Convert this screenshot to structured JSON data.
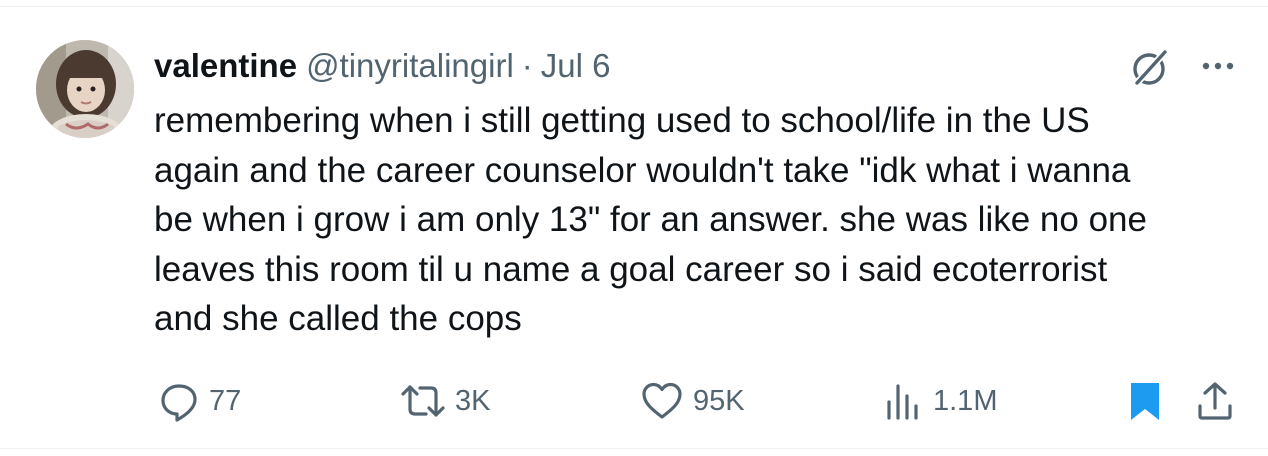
{
  "tweet": {
    "display_name": "valentine",
    "handle": "@tinyritalingirl",
    "separator": "·",
    "date": "Jul 6",
    "text": "remembering when i still getting used to school/life in the US\nagain and the career counselor wouldn't take \"idk what i wanna\nbe when i grow i am only 13\" for an answer. she was like no one\nleaves this room til u name a goal career so i said ecoterrorist\nand she called the cops"
  },
  "actions": {
    "replies": "77",
    "reposts": "3K",
    "likes": "95K",
    "views": "1.1M"
  },
  "colors": {
    "text": "#0f1419",
    "secondary": "#536471",
    "bookmark": "#1d9bf0",
    "divider": "#eff3f4"
  },
  "icons": {
    "reply": "reply-icon",
    "repost": "repost-icon",
    "like": "heart-icon",
    "views": "views-icon",
    "bookmark": "bookmark-icon",
    "share": "share-icon",
    "grok": "grok-icon",
    "more": "more-icon"
  }
}
